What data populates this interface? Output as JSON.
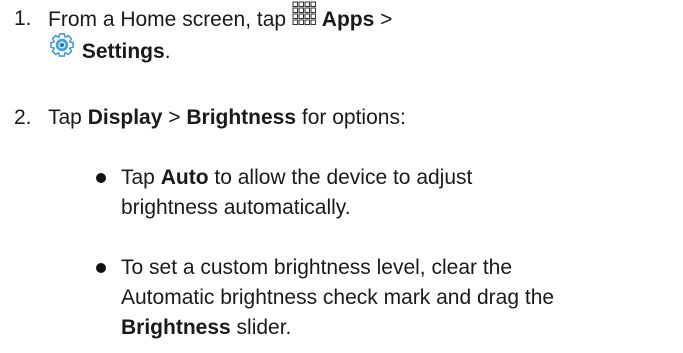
{
  "steps": [
    {
      "number": "1.",
      "prefix": "From a Home screen, tap",
      "apps_label": "Apps",
      "separator": ">",
      "settings_label": "Settings",
      "suffix": "."
    },
    {
      "number": "2.",
      "prefix": "Tap",
      "display_label": "Display",
      "separator": ">",
      "brightness_label": "Brightness",
      "suffix": "for options:"
    }
  ],
  "bullets": [
    {
      "prefix": "Tap",
      "bold": "Auto",
      "line1_rest": "to allow the device to adjust",
      "line2": "brightness automatically."
    },
    {
      "line1": "To set a custom brightness level, clear the",
      "line2": "Automatic brightness check mark and drag the",
      "bold": "Brightness",
      "line3_rest": "slider."
    }
  ],
  "icons": {
    "apps": "apps-grid-icon",
    "settings": "settings-gear-icon"
  },
  "colors": {
    "text": "#1a1a1a",
    "settings_icon_outer": "#3b9fe0",
    "settings_icon_inner": "#1e6fb8"
  }
}
